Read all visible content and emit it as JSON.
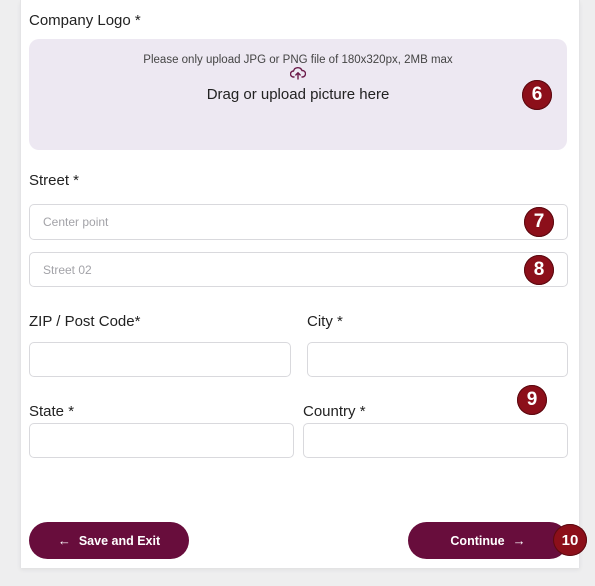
{
  "form": {
    "logo_label": "Company Logo *",
    "upload_hint": "Please only upload JPG or PNG file of 180x320px, 2MB max",
    "upload_main": "Drag or upload picture here",
    "street_label": "Street *",
    "street1_placeholder": "Center point",
    "street2_placeholder": "Street 02",
    "zip_label": "ZIP / Post Code*",
    "city_label": "City *",
    "state_label": "State *",
    "country_label": "Country *",
    "zip_value": "",
    "city_value": "",
    "state_value": "",
    "country_value": ""
  },
  "badges": {
    "b6": "6",
    "b7": "7",
    "b8": "8",
    "b9": "9",
    "b10": "10"
  },
  "actions": {
    "save_label": "Save and Exit",
    "save_icon": "arrow-left-icon",
    "continue_label": "Continue",
    "continue_icon": "arrow-right-icon"
  },
  "colors": {
    "primary": "#680d3c",
    "badge": "#8c0f1a",
    "upload_bg": "#ede8f2"
  }
}
